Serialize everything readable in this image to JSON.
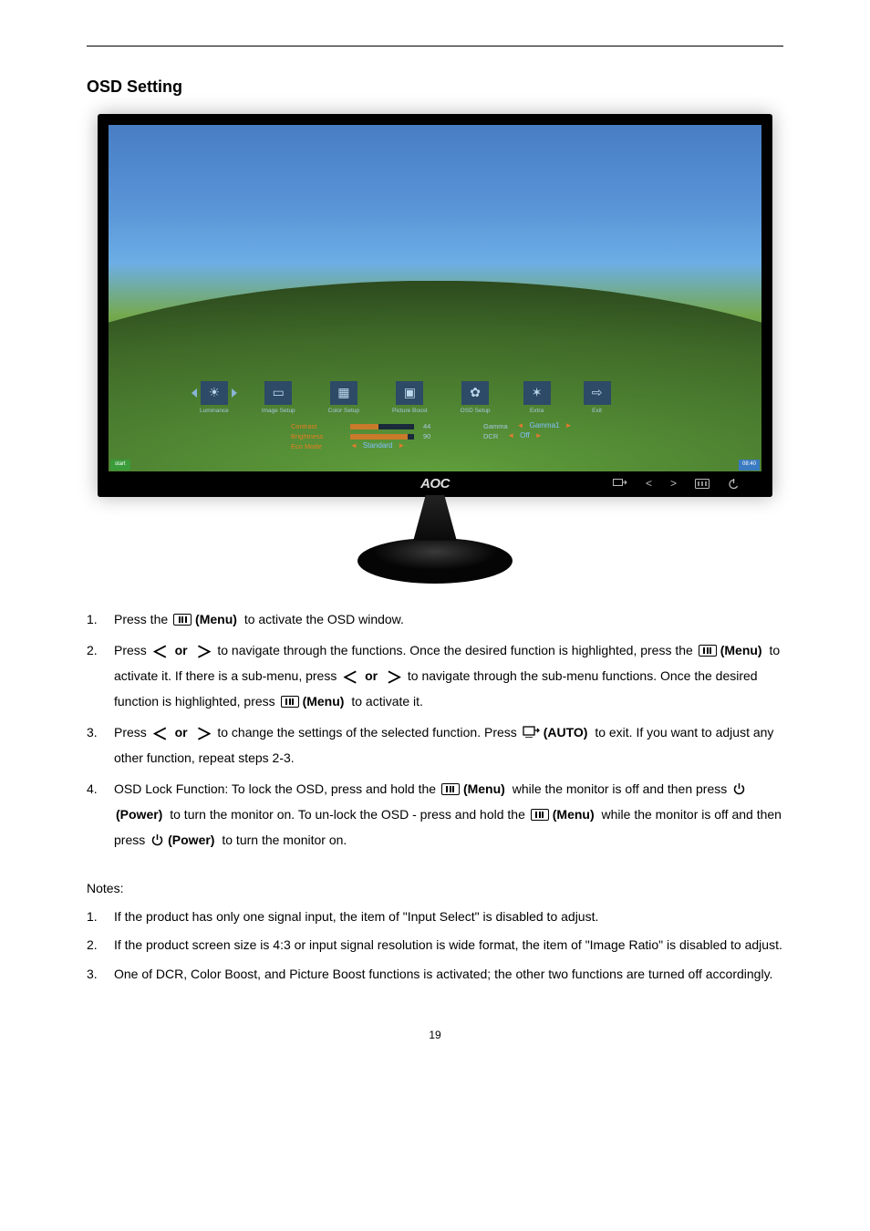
{
  "headings": {
    "osd_setting": "OSD Setting",
    "notes": "Notes:"
  },
  "monitor": {
    "brand": "AOC",
    "bezel_buttons": {
      "source": "source/auto",
      "left": "<",
      "right": ">",
      "menu": "menu",
      "power": "power"
    },
    "osd": {
      "icons": [
        {
          "label": "Luminance",
          "glyph": "☀",
          "active": true
        },
        {
          "label": "Image Setup",
          "glyph": "▭"
        },
        {
          "label": "Color Setup",
          "glyph": "▦"
        },
        {
          "label": "Picture Boost",
          "glyph": "▣"
        },
        {
          "label": "OSD Setup",
          "glyph": "✿"
        },
        {
          "label": "Extra",
          "glyph": "✶"
        },
        {
          "label": "Exit",
          "glyph": "⇨"
        }
      ],
      "rows": [
        {
          "label": "Contrast",
          "value": "44",
          "bar_pct": 44,
          "opt_label": "Gamma",
          "opt_value": "Gamma1"
        },
        {
          "label": "Brightness",
          "value": "90",
          "bar_pct": 90,
          "opt_label": "DCR",
          "opt_value": "Off"
        },
        {
          "label": "Eco Mode",
          "opt_value": "Standard"
        }
      ]
    },
    "taskbar": {
      "start": "start",
      "clock": "08:40"
    }
  },
  "icon_labels": {
    "menu": "(Menu)",
    "or": "or",
    "auto": "(AUTO)",
    "power": "(Power)"
  },
  "instructions": {
    "i1_a": "Press the ",
    "i1_b": " to activate the OSD window.",
    "i2_a": "Press ",
    "i2_b": " to navigate through the functions. Once the desired function is highlighted, press the ",
    "i2_c": " to activate it. If there is a sub-menu, press ",
    "i2_d": " to navigate through the sub-menu functions. Once the desired function is highlighted, press ",
    "i2_e": " to activate it.",
    "i3_a": "Press ",
    "i3_b": " to change the settings of the selected function. Press ",
    "i3_c": " to exit.   If you want to adjust any other function, repeat steps 2-3.",
    "i4_a": "OSD Lock Function: To lock the OSD, press and hold the ",
    "i4_b": " while the monitor is off and then press ",
    "i4_c": " to turn the monitor on. To un-lock the OSD - press and hold the ",
    "i4_d": " while the monitor is off and then press ",
    "i4_e": " to turn the monitor on."
  },
  "notes": {
    "n1": "If the product has only one signal input, the item of \"Input Select\" is disabled to adjust.",
    "n2": "If the product screen size is 4:3 or input signal resolution is wide format, the item of \"Image Ratio\" is disabled to adjust.",
    "n3": "One of DCR, Color Boost, and Picture Boost functions is activated; the other two functions are turned off accordingly."
  },
  "page_number": "19"
}
